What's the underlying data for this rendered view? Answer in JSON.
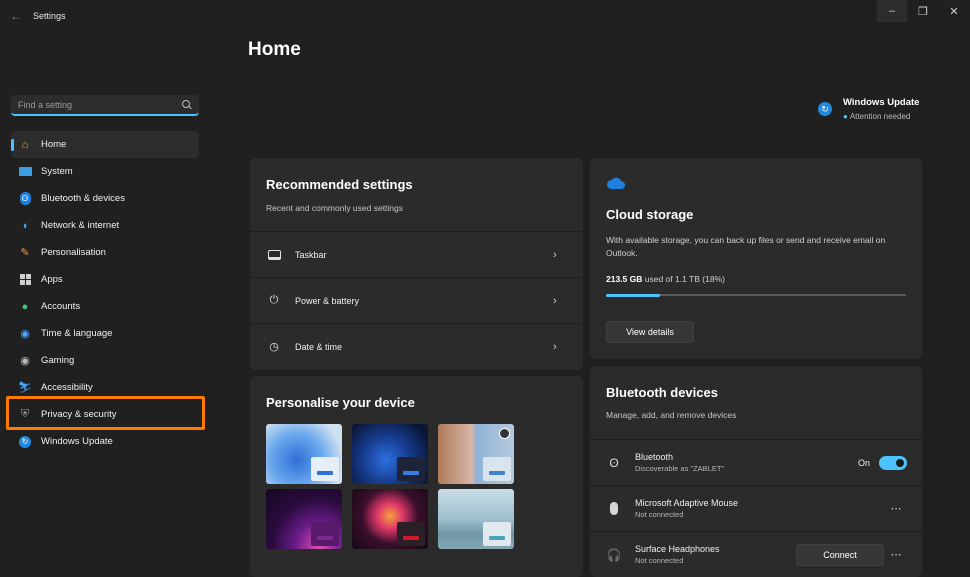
{
  "window": {
    "title": "Settings"
  },
  "sidebar": {
    "search_placeholder": "Find a setting",
    "items": [
      {
        "label": "Home",
        "icon": "home-icon",
        "active": true
      },
      {
        "label": "System",
        "icon": "system-icon"
      },
      {
        "label": "Bluetooth & devices",
        "icon": "bluetooth-icon"
      },
      {
        "label": "Network & internet",
        "icon": "wifi-icon"
      },
      {
        "label": "Personalisation",
        "icon": "brush-icon"
      },
      {
        "label": "Apps",
        "icon": "apps-icon"
      },
      {
        "label": "Accounts",
        "icon": "account-icon"
      },
      {
        "label": "Time & language",
        "icon": "globe-icon"
      },
      {
        "label": "Gaming",
        "icon": "gamepad-icon"
      },
      {
        "label": "Accessibility",
        "icon": "accessibility-icon"
      },
      {
        "label": "Privacy & security",
        "icon": "shield-icon",
        "highlighted": true
      },
      {
        "label": "Windows Update",
        "icon": "update-icon"
      }
    ]
  },
  "main": {
    "title": "Home",
    "windows_update": {
      "title": "Windows Update",
      "status": "Attention needed"
    },
    "recommended": {
      "title": "Recommended settings",
      "subtitle": "Recent and commonly used settings",
      "items": [
        {
          "label": "Taskbar",
          "icon": "taskbar-icon"
        },
        {
          "label": "Power & battery",
          "icon": "power-icon"
        },
        {
          "label": "Date & time",
          "icon": "clock-icon"
        }
      ]
    },
    "personalise": {
      "title": "Personalise your device",
      "themes": [
        "theme-1",
        "theme-2",
        "theme-3",
        "theme-4",
        "theme-5",
        "theme-6"
      ]
    },
    "cloud": {
      "title": "Cloud storage",
      "description": "With available storage, you can back up files or send and receive email on Outlook.",
      "used": "213.5 GB",
      "total_text": "used of 1.1 TB (18%)",
      "used_fraction": 0.18,
      "button": "View details"
    },
    "bluetooth": {
      "title": "Bluetooth devices",
      "subtitle": "Manage, add, and remove devices",
      "bt_row": {
        "name": "Bluetooth",
        "status": "Discoverable as \"ZABLET\"",
        "toggle_label": "On"
      },
      "devices": [
        {
          "name": "Microsoft Adaptive Mouse",
          "status": "Not connected"
        },
        {
          "name": "Surface Headphones",
          "status": "Not connected",
          "button": "Connect"
        }
      ]
    }
  },
  "colors": {
    "accent": "#4cc2ff",
    "highlight": "#ff7a00",
    "background": "#202020",
    "card": "#2b2b2b"
  }
}
